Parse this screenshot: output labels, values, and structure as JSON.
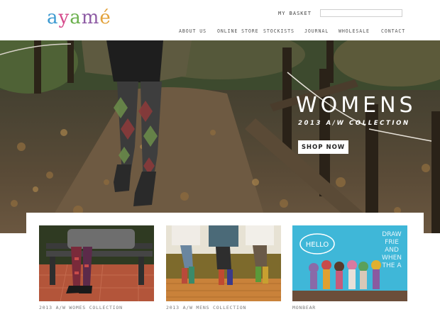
{
  "brand": {
    "logo_text": "ayamé",
    "logo_colors": [
      "#d64b8c",
      "#3d9ad1",
      "#e3a23b",
      "#6ab04c",
      "#8e5ca5",
      "#444444"
    ]
  },
  "header": {
    "basket_label": "MY BASKET",
    "search_value": "",
    "search_placeholder": ""
  },
  "nav": {
    "items": [
      "ABOUT US",
      "ONLINE STORE",
      "STOCKISTS",
      "JOURNAL",
      "WHOLESALE",
      "CONTACT"
    ]
  },
  "hero": {
    "title": "WOMENS",
    "subtitle": "2013 A/W COLLECTION",
    "button_label": "SHOP NOW"
  },
  "collections": [
    {
      "caption": "2013 A/W WOMES COLLECTION"
    },
    {
      "caption": "2013 A/W MENS COLLECTION"
    },
    {
      "caption": "MONBEAR",
      "sign_text": "HELLO",
      "wall_text": "DRAW FRIE AND WHEN THE A"
    }
  ]
}
